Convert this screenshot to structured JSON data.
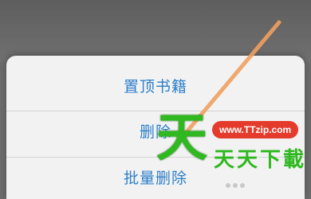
{
  "menu": {
    "items": [
      {
        "label": "置顶书籍"
      },
      {
        "label": "删除"
      },
      {
        "label": "批量删除"
      }
    ]
  },
  "watermark": {
    "logo_char": "天",
    "url": "www.TTzip.com",
    "name": "天天下載"
  },
  "colors": {
    "menu_text": "#2d7fc9",
    "sheet_bg": "#f2f2f2",
    "backdrop": "#6b6b6b",
    "stroke": "#f0a060",
    "watermark_green": "#2fb81f",
    "watermark_red": "#e53b2c"
  }
}
